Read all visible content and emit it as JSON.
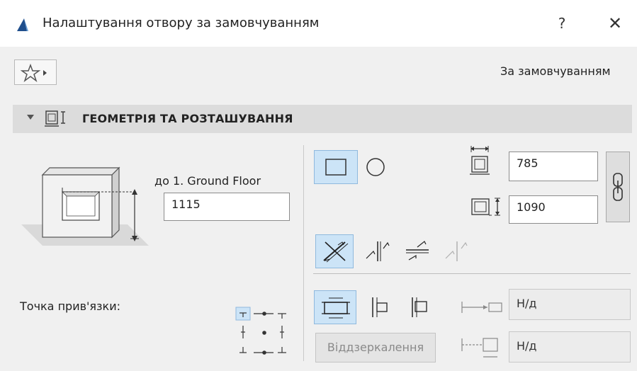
{
  "window": {
    "title": "Налаштування отвору за замовчуванням",
    "help_label": "?",
    "close_label": "✕"
  },
  "toolbar": {
    "favorites_icon": "star-icon",
    "preset_label": "За замовчуванням"
  },
  "section": {
    "title": "ГЕОМЕТРІЯ ТА РОЗТАШУВАННЯ",
    "expanded": true
  },
  "left_panel": {
    "floor_label": "до 1. Ground Floor",
    "height_value": "1115",
    "anchor_label": "Точка прив'язки:",
    "anchor_selected": "top-left"
  },
  "right_panel": {
    "shapes": [
      {
        "name": "rectangular",
        "selected": true
      },
      {
        "name": "circular",
        "selected": false
      }
    ],
    "width_value": "785",
    "height_value": "1090",
    "orientation_selected": 0,
    "reveal_selected": 0,
    "dim1_value": "Н/д",
    "dim2_value": "Н/д",
    "mirror_label": "Віддзеркалення"
  },
  "colors": {
    "accent_selected": "#cce4f7",
    "section_band": "#dcdcdc",
    "background": "#f0f0f0"
  }
}
